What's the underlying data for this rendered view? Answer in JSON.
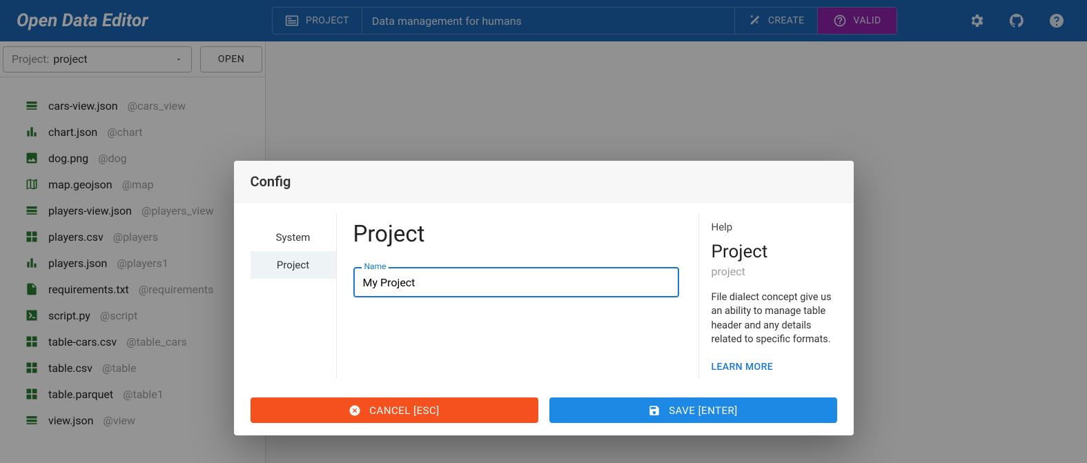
{
  "app": {
    "title": "Open Data Editor"
  },
  "header": {
    "project_label": "PROJECT",
    "tagline": "Data management for humans",
    "create_label": "CREATE",
    "valid_label": "VALID"
  },
  "sidebar": {
    "select_label": "Project:",
    "select_value": "project",
    "open_label": "OPEN",
    "files": [
      {
        "icon": "view",
        "name": "cars-view.json",
        "alias": "@cars_view"
      },
      {
        "icon": "chart",
        "name": "chart.json",
        "alias": "@chart"
      },
      {
        "icon": "image",
        "name": "dog.png",
        "alias": "@dog"
      },
      {
        "icon": "map",
        "name": "map.geojson",
        "alias": "@map"
      },
      {
        "icon": "view",
        "name": "players-view.json",
        "alias": "@players_view"
      },
      {
        "icon": "grid",
        "name": "players.csv",
        "alias": "@players"
      },
      {
        "icon": "chart",
        "name": "players.json",
        "alias": "@players1"
      },
      {
        "icon": "file",
        "name": "requirements.txt",
        "alias": "@requirements"
      },
      {
        "icon": "script",
        "name": "script.py",
        "alias": "@script"
      },
      {
        "icon": "grid",
        "name": "table-cars.csv",
        "alias": "@table_cars"
      },
      {
        "icon": "grid",
        "name": "table.csv",
        "alias": "@table"
      },
      {
        "icon": "grid",
        "name": "table.parquet",
        "alias": "@table1"
      },
      {
        "icon": "view",
        "name": "view.json",
        "alias": "@view"
      }
    ]
  },
  "dialog": {
    "title": "Config",
    "nav": {
      "system": "System",
      "project": "Project"
    },
    "main": {
      "heading": "Project",
      "name_label": "Name",
      "name_value": "My Project"
    },
    "help": {
      "label": "Help",
      "title": "Project",
      "subtitle": "project",
      "text": "File dialect concept give us an ability to manage table header and any details related to specific formats.",
      "learn_more": "LEARN MORE"
    },
    "actions": {
      "cancel": "CANCEL [ESC]",
      "save": "SAVE [ENTER]"
    }
  }
}
